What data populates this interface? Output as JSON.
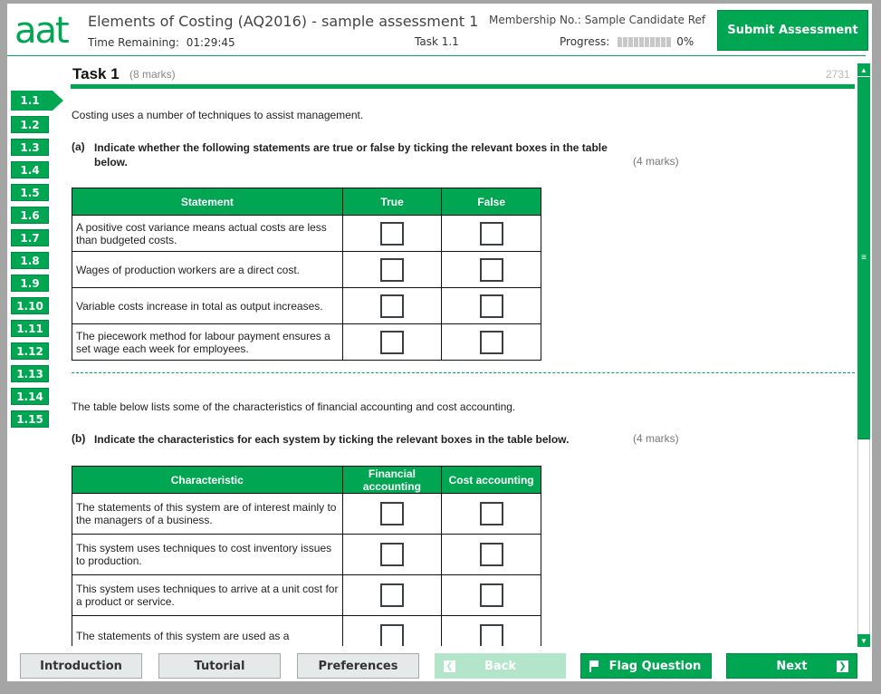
{
  "header": {
    "logo": "aat",
    "title": "Elements of Costing (AQ2016) - sample assessment 1",
    "time_label": "Time Remaining:",
    "time_value": "01:29:45",
    "task_label": "Task 1.1",
    "membership_label": "Membership No.:",
    "membership_value": "Sample Candidate Ref",
    "progress_label": "Progress:",
    "progress_percent": 0,
    "progress_text": "0%",
    "progress_segments": 10,
    "submit_label": "Submit Assessment"
  },
  "task": {
    "title": "Task 1",
    "marks": "(8 marks)",
    "id": "2731"
  },
  "nav": {
    "active": "1.1",
    "items": [
      "1.1",
      "1.2",
      "1.3",
      "1.4",
      "1.5",
      "1.6",
      "1.7",
      "1.8",
      "1.9",
      "1.10",
      "1.11",
      "1.12",
      "1.13",
      "1.14",
      "1.15"
    ]
  },
  "content": {
    "intro": "Costing uses a number of techniques to assist management.",
    "part_a": {
      "label": "(a)",
      "text": "Indicate whether the following statements are true or false by ticking the relevant boxes in the table below.",
      "marks": "(4 marks)",
      "columns": [
        "Statement",
        "True",
        "False"
      ],
      "rows": [
        "A positive cost variance means actual costs are less than budgeted costs.",
        "Wages of production workers are a direct cost.",
        "Variable costs increase in total as output increases.",
        "The piecework method for labour payment ensures a set wage each week for employees."
      ]
    },
    "intro_b": "The table below lists some of the characteristics of financial accounting and cost accounting.",
    "part_b": {
      "label": "(b)",
      "text": "Indicate the characteristics for each system by ticking the relevant boxes in the table below.",
      "marks": "(4 marks)",
      "columns": [
        "Characteristic",
        "Financial accounting",
        "Cost accounting"
      ],
      "rows": [
        "The statements of this system are of interest mainly to the managers of a business.",
        "This system uses techniques to cost inventory issues to production.",
        "This system uses techniques to arrive at a unit cost for a product or service.",
        "The statements of this system are used as a"
      ]
    }
  },
  "footer": {
    "introduction": "Introduction",
    "tutorial": "Tutorial",
    "preferences": "Preferences",
    "back": "Back",
    "flag": "Flag Question",
    "next": "Next"
  },
  "colors": {
    "brand": "#00a651",
    "disabled": "#b3e5cb",
    "grey_button": "#e6e9ea"
  }
}
